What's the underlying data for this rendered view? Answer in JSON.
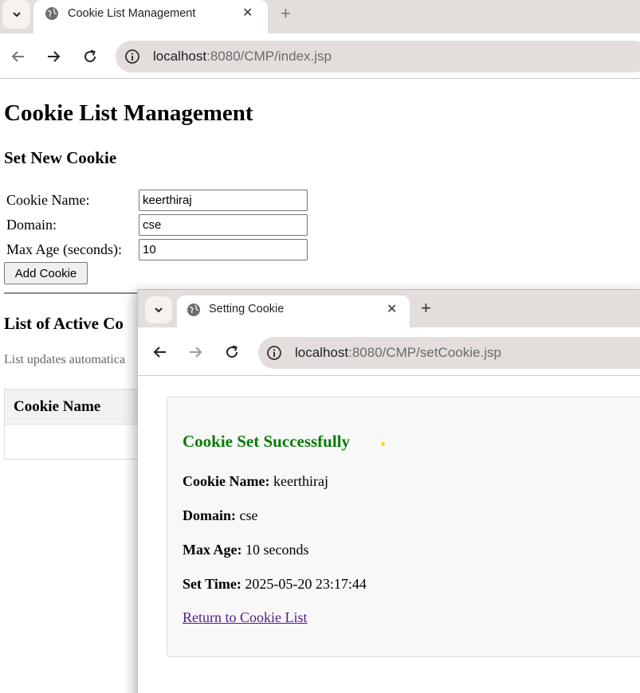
{
  "browser": {
    "tab_title": "Cookie List Management",
    "url_host": "localhost",
    "url_rest": ":8080/CMP/index.jsp"
  },
  "page": {
    "title": "Cookie List Management",
    "set_heading": "Set New Cookie",
    "form": {
      "name_label": "Cookie Name:",
      "name_value": "keerthiraj",
      "domain_label": "Domain:",
      "domain_value": "cse",
      "maxage_label": "Max Age (seconds):",
      "maxage_value": "10",
      "add_button": "Add Cookie"
    },
    "list_heading": "List of Active Co",
    "list_note": "List updates automatica",
    "table_header_name": "Cookie Name"
  },
  "popup": {
    "tab_title": "Setting Cookie",
    "url_host": "localhost",
    "url_rest": ":8080/CMP/setCookie.jsp",
    "card": {
      "title": "Cookie Set Successfully",
      "name_label": "Cookie Name:",
      "name_value": " keerthiraj",
      "domain_label": "Domain:",
      "domain_value": " cse",
      "maxage_label": "Max Age:",
      "maxage_value": " 10 seconds",
      "settime_label": "Set Time:",
      "settime_value": " 2025-05-20 23:17:44",
      "return_link": "Return to Cookie List"
    }
  },
  "colors": {
    "success_green": "#0a7a0a",
    "visited_link": "#551a8b",
    "chrome_bg": "#e3dedb"
  }
}
